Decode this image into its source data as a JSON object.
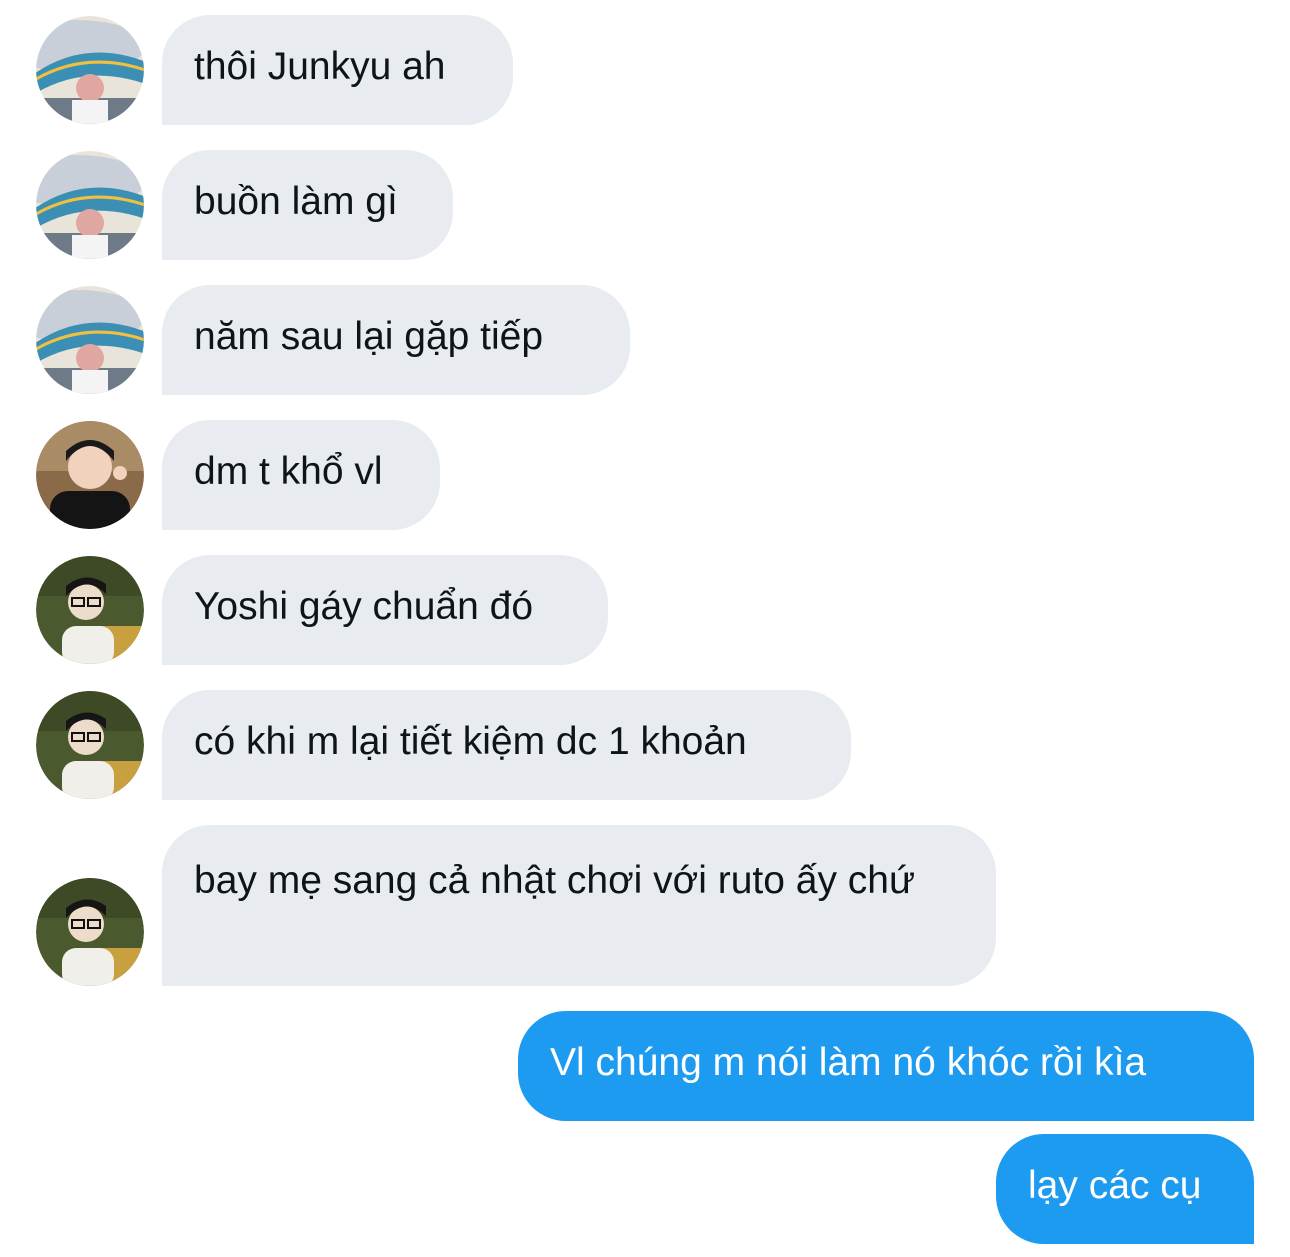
{
  "colors": {
    "incoming_bubble": "#e8ecf0",
    "outgoing_bubble": "#1d9bf0",
    "incoming_text": "#0f1419",
    "outgoing_text": "#ffffff"
  },
  "messages": [
    {
      "direction": "incoming",
      "avatar": "yoshi-stadium",
      "text": "thôi Junkyu ah"
    },
    {
      "direction": "incoming",
      "avatar": "yoshi-stadium",
      "text": "buồn làm gì"
    },
    {
      "direction": "incoming",
      "avatar": "yoshi-stadium",
      "text": "năm sau lại gặp tiếp"
    },
    {
      "direction": "incoming",
      "avatar": "dark-shirt-pose",
      "text": "dm t khổ vl"
    },
    {
      "direction": "incoming",
      "avatar": "glasses-guy",
      "text": "Yoshi gáy chuẩn đó"
    },
    {
      "direction": "incoming",
      "avatar": "glasses-guy",
      "text": "có khi m lại tiết kiệm dc 1 khoản"
    },
    {
      "direction": "incoming",
      "avatar": "glasses-guy",
      "text": "bay mẹ sang cả nhật chơi với ruto ấy chứ"
    },
    {
      "direction": "outgoing",
      "text": "Vl chúng m nói làm nó khóc rồi kìa"
    },
    {
      "direction": "outgoing",
      "text": "lạy các cụ"
    }
  ]
}
